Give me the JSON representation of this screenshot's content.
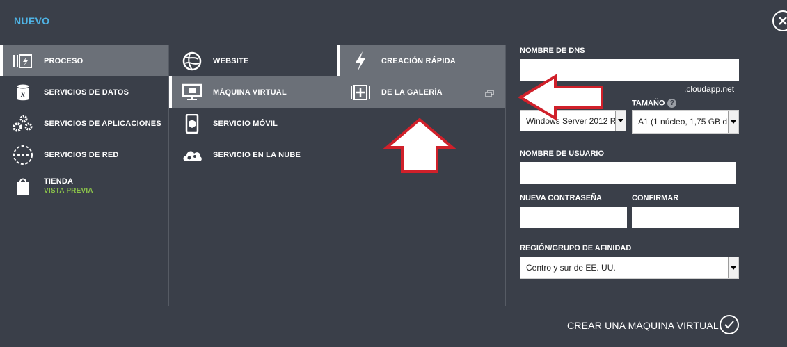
{
  "header": {
    "title": "NUEVO"
  },
  "col1": {
    "items": [
      {
        "label": "PROCESO"
      },
      {
        "label": "SERVICIOS DE DATOS"
      },
      {
        "label": "SERVICIOS DE APLICACIONES"
      },
      {
        "label": "SERVICIOS DE RED"
      },
      {
        "label": "TIENDA",
        "sub": "VISTA PREVIA"
      }
    ]
  },
  "col2": {
    "items": [
      {
        "label": "WEBSITE"
      },
      {
        "label": "MÁQUINA VIRTUAL"
      },
      {
        "label": "SERVICIO MÓVIL"
      },
      {
        "label": "SERVICIO EN LA NUBE"
      }
    ]
  },
  "col3": {
    "items": [
      {
        "label": "CREACIÓN RÁPIDA"
      },
      {
        "label": "DE LA GALERÍA"
      }
    ]
  },
  "form": {
    "dns_label": "NOMBRE DE DNS",
    "dns_value": "",
    "dns_suffix": ".cloudapp.net",
    "image_value": "Windows Server 2012 R",
    "size_label": "TAMAÑO",
    "size_value": "A1 (1 núcleo, 1,75 GB d",
    "help": "?",
    "user_label": "NOMBRE DE USUARIO",
    "user_value": "",
    "password_label": "NUEVA CONTRASEÑA",
    "password_value": "",
    "confirm_label": "CONFIRMAR",
    "confirm_value": "",
    "region_label": "REGIÓN/GRUPO DE AFINIDAD",
    "region_value": "Centro y sur de EE. UU."
  },
  "footer": {
    "create_label": "CREAR UNA MÁQUINA VIRTUAL"
  },
  "colors": {
    "background": "#3a3f49",
    "selected": "#6b7078",
    "title": "#4fb4e6",
    "preview": "#8bc34a",
    "arrow": "#d0202a"
  }
}
